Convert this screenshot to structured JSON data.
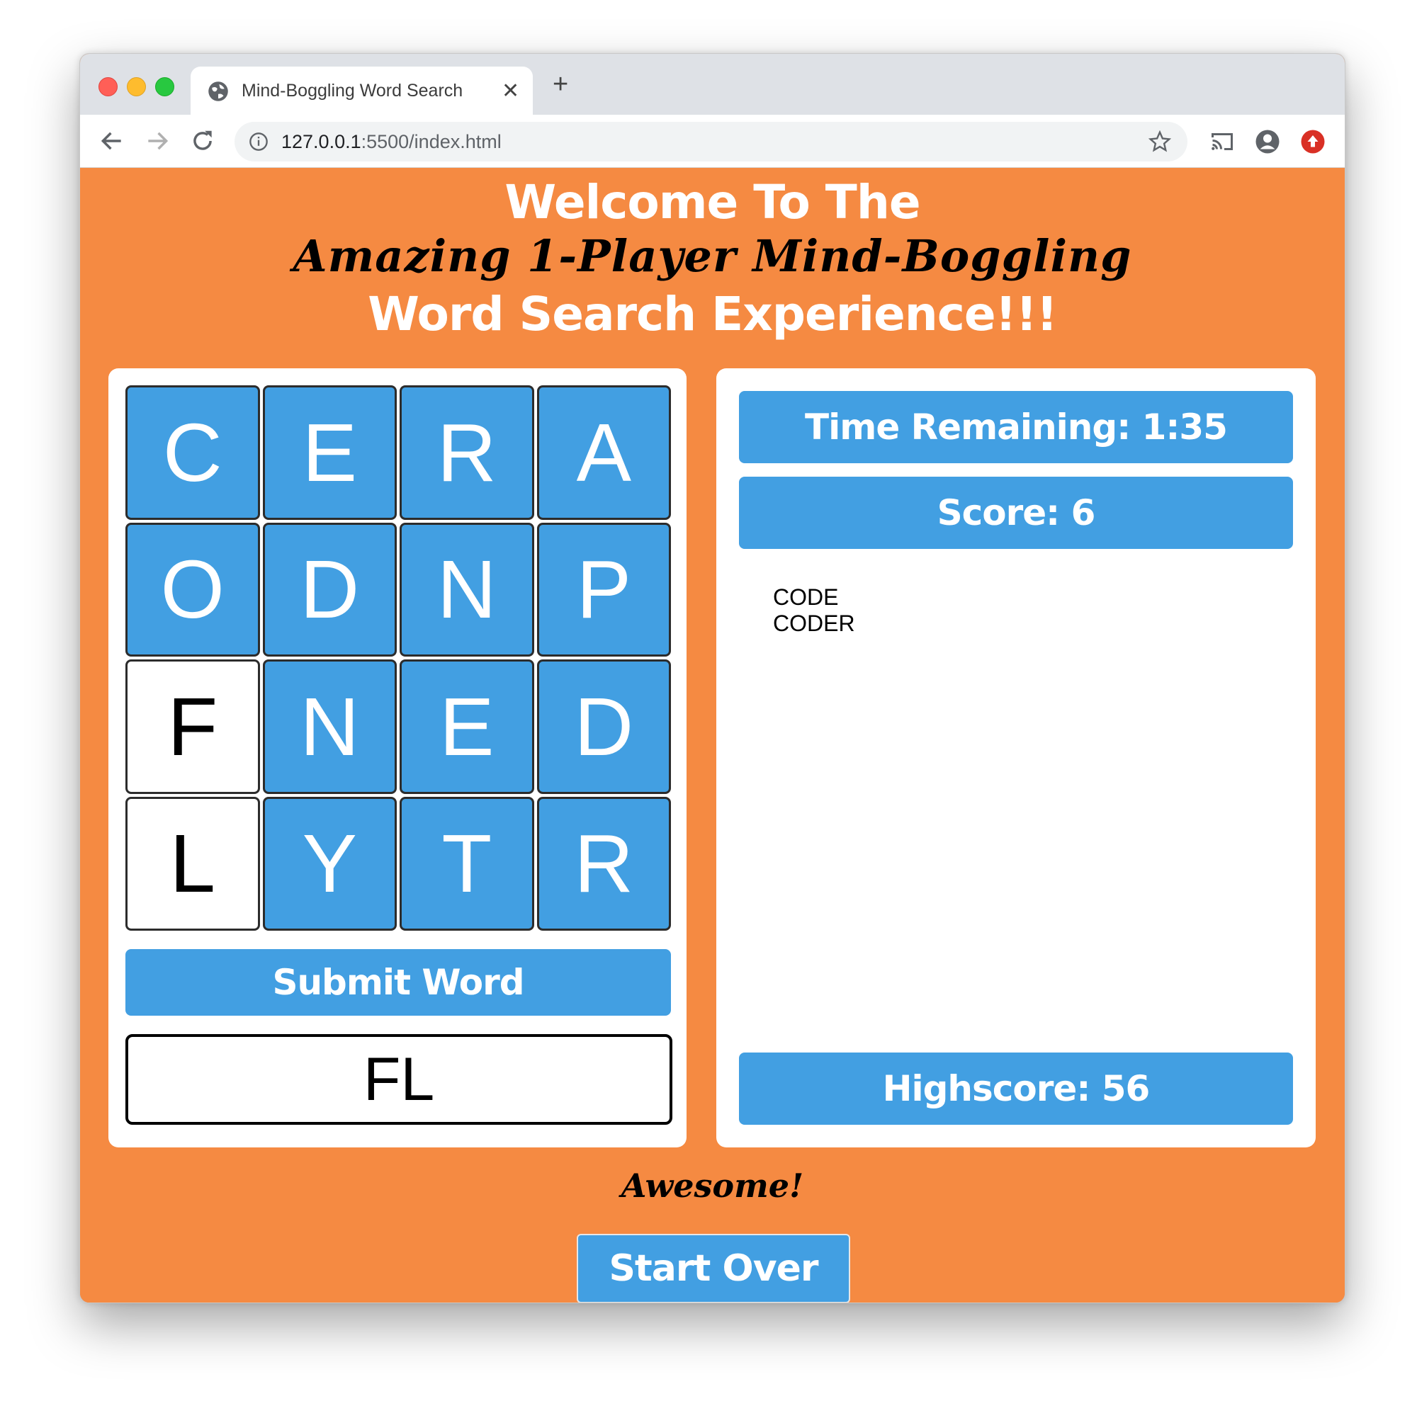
{
  "browser": {
    "tab_title": "Mind-Boggling Word Search",
    "new_tab": "+",
    "close_tab": "✕",
    "url_host": "127.0.0.1",
    "url_rest": ":5500/index.html"
  },
  "header": {
    "line1": "Welcome To The",
    "line2": "Amazing 1-Player Mind-Boggling",
    "line3": "Word Search Experience!!!"
  },
  "board": {
    "cells": [
      "C",
      "E",
      "R",
      "A",
      "O",
      "D",
      "N",
      "P",
      "F",
      "N",
      "E",
      "D",
      "L",
      "Y",
      "T",
      "R"
    ],
    "selected": [
      8,
      12
    ],
    "submit_label": "Submit Word",
    "current_word": "FL"
  },
  "stats": {
    "time_remaining": "Time Remaining: 1:35",
    "score": "Score: 6",
    "highscore": "Highscore: 56",
    "found_words": [
      "CODE",
      "CODER"
    ]
  },
  "footer": {
    "message": "Awesome!",
    "start_over": "Start Over"
  },
  "colors": {
    "page_bg": "#f58a42",
    "tile_blue": "#429fe2",
    "tile_selected": "#ffffff"
  }
}
